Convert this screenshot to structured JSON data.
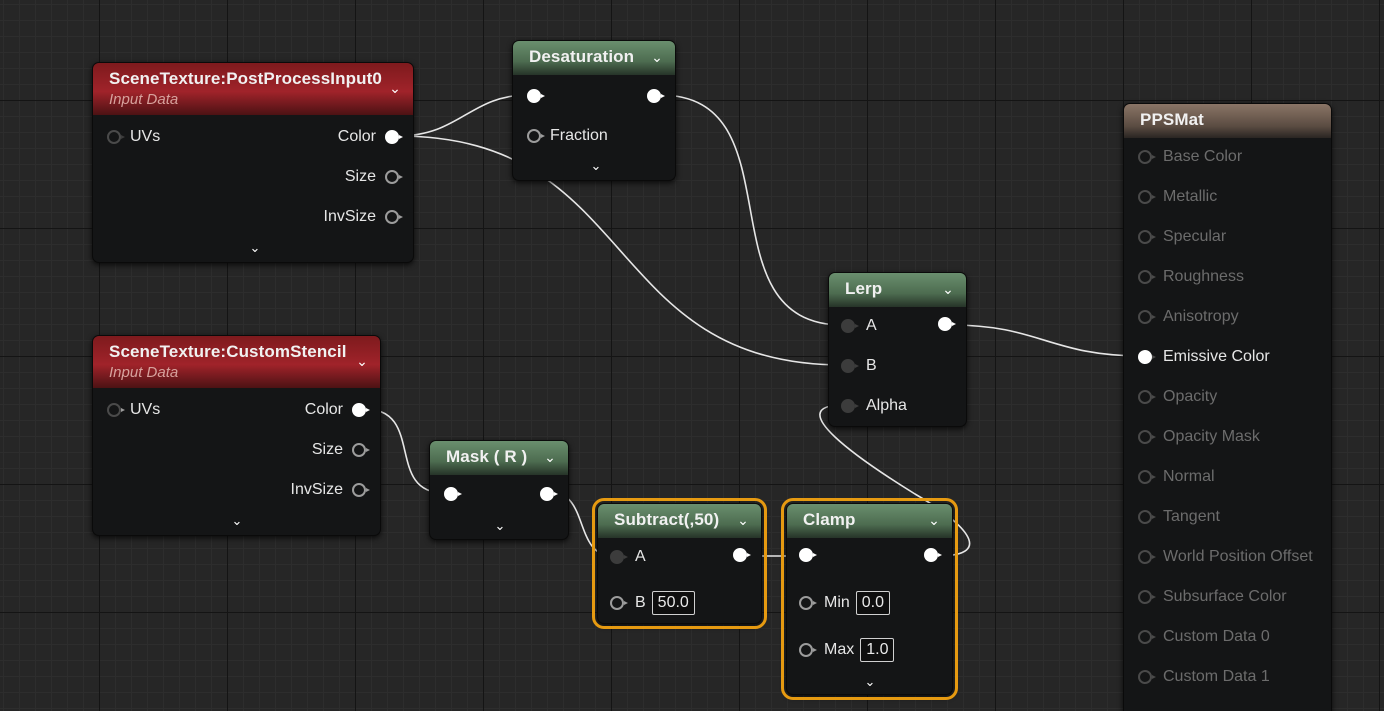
{
  "nodes": {
    "post_process": {
      "title": "SceneTexture:PostProcessInput0",
      "subtitle": "Input Data",
      "inputs": [
        "UVs"
      ],
      "outputs": [
        "Color",
        "Size",
        "InvSize"
      ]
    },
    "custom_stencil": {
      "title": "SceneTexture:CustomStencil",
      "subtitle": "Input Data",
      "inputs": [
        "UVs"
      ],
      "outputs": [
        "Color",
        "Size",
        "InvSize"
      ]
    },
    "desaturation": {
      "title": "Desaturation",
      "inputs": [
        "",
        "Fraction"
      ]
    },
    "mask": {
      "title": "Mask ( R )"
    },
    "lerp": {
      "title": "Lerp",
      "inputs": [
        "A",
        "B",
        "Alpha"
      ]
    },
    "subtract": {
      "title": "Subtract(,50)",
      "inputs": [
        "A",
        "B"
      ],
      "b_value": "50.0"
    },
    "clamp": {
      "title": "Clamp",
      "inputs": [
        "",
        "Min",
        "Max"
      ],
      "min_value": "0.0",
      "max_value": "1.0"
    },
    "material": {
      "title": "PPSMat",
      "inputs": [
        "Base Color",
        "Metallic",
        "Specular",
        "Roughness",
        "Anisotropy",
        "Emissive Color",
        "Opacity",
        "Opacity Mask",
        "Normal",
        "Tangent",
        "World Position Offset",
        "Subsurface Color",
        "Custom Data 0",
        "Custom Data 1"
      ],
      "active_input": "Emissive Color"
    }
  },
  "icons": {
    "collapse": "chevron-down-icon",
    "expand": "chevron-down-icon"
  },
  "colors": {
    "grid_bg": "#262626",
    "selection": "#e69a11",
    "texture_header": "#a0232a",
    "math_header": "#4d6c50",
    "material_header": "#5b4c42",
    "wire": "#e6e6e6"
  }
}
